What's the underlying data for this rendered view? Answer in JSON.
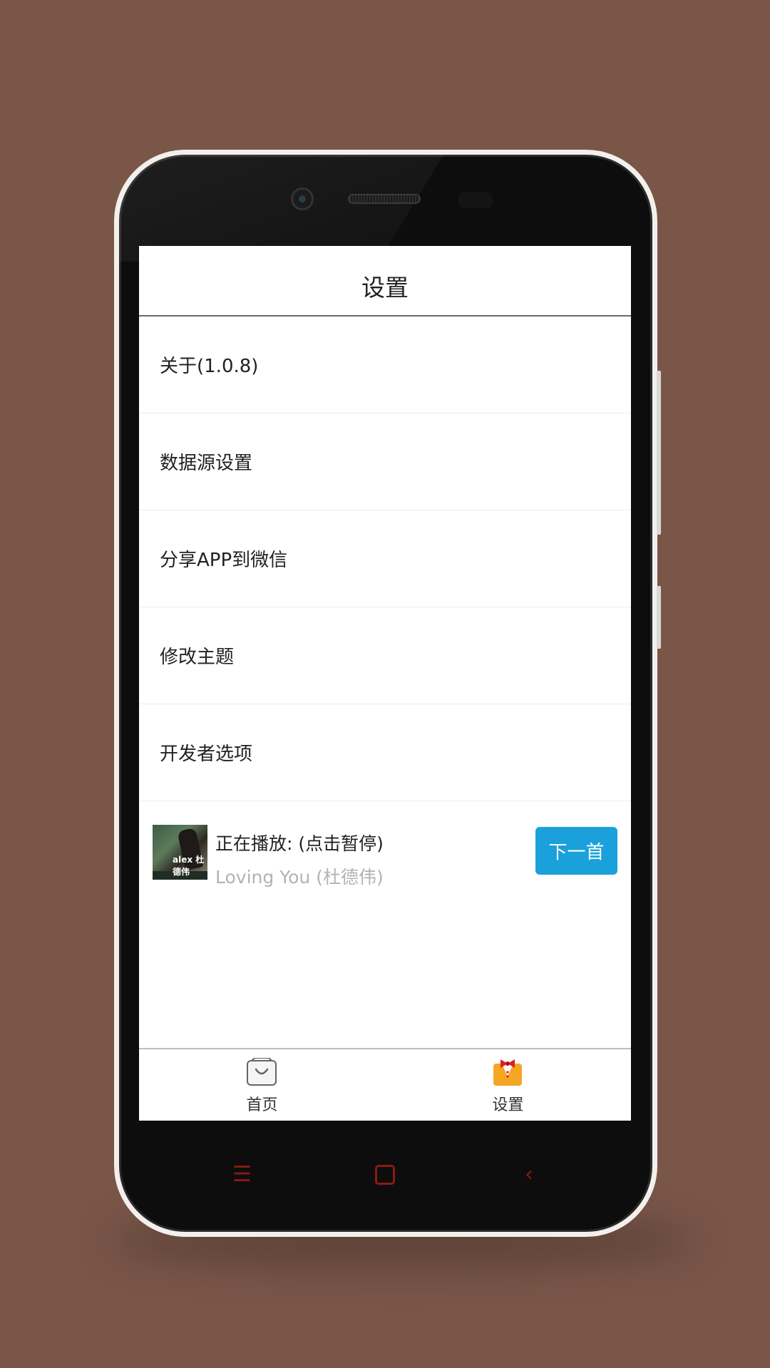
{
  "header": {
    "title": "设置"
  },
  "menu": [
    {
      "label": "关于(1.0.8)"
    },
    {
      "label": "数据源设置"
    },
    {
      "label": "分享APP到微信"
    },
    {
      "label": "修改主题"
    },
    {
      "label": "开发者选项"
    }
  ],
  "player": {
    "status": "正在播放: (点击暂停)",
    "song": "Loving You (杜德伟)",
    "next_label": "下一首",
    "cover_text": "alex 杜德伟"
  },
  "tabs": [
    {
      "label": "首页",
      "icon": "shopping-bag-icon"
    },
    {
      "label": "设置",
      "icon": "tuxedo-bowtie-icon"
    }
  ],
  "nav": {
    "menu_icon": "menu-icon",
    "home_icon": "home-icon",
    "back_icon": "back-icon"
  },
  "colors": {
    "accent": "#1aa1db",
    "background": "#7a5649",
    "nav_keys": "#8b1a14"
  }
}
